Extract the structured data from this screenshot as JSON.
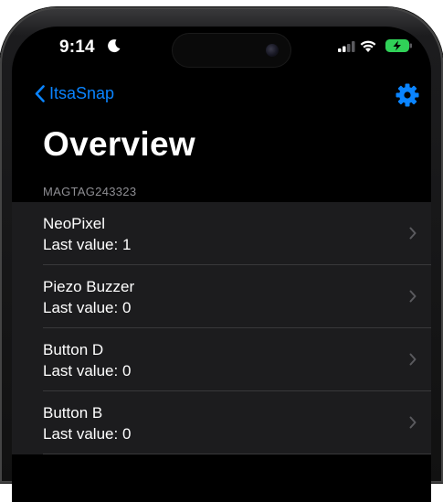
{
  "status_bar": {
    "time": "9:14",
    "icons": [
      "moon-icon",
      "signal-icon",
      "wifi-icon",
      "battery-charging-icon"
    ]
  },
  "nav": {
    "back_label": "ItsaSnap",
    "settings_icon": "gear-icon"
  },
  "page": {
    "title": "Overview",
    "section_header": "MAGTAG243323"
  },
  "items": [
    {
      "name": "NeoPixel",
      "value": "Last value: 1"
    },
    {
      "name": "Piezo Buzzer",
      "value": "Last value: 0"
    },
    {
      "name": "Button D",
      "value": "Last value: 0"
    },
    {
      "name": "Button B",
      "value": "Last value: 0"
    }
  ],
  "colors": {
    "accent": "#0a84ff",
    "background": "#000000",
    "cell": "#1c1c1e",
    "secondary_text": "#8e8e93",
    "battery": "#30d158"
  }
}
